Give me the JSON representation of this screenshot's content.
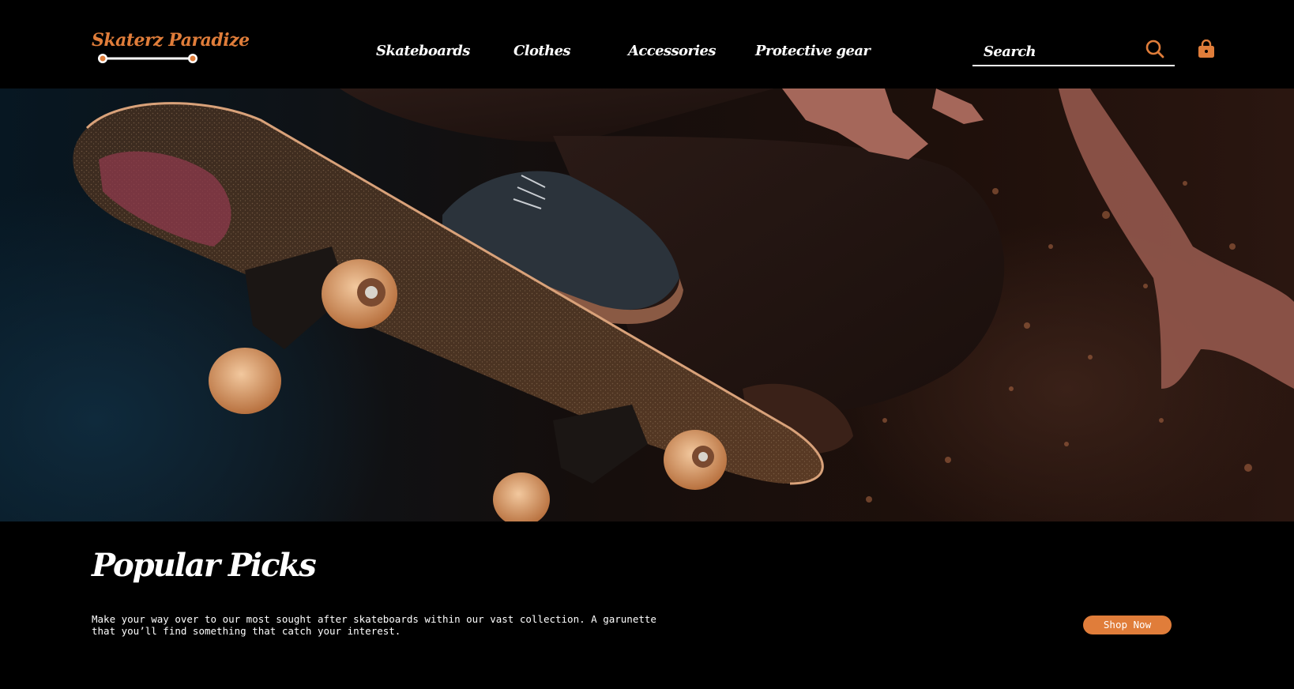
{
  "brand": {
    "name": "Skaterz Paradize",
    "accent_color": "#e07d3a"
  },
  "nav": {
    "items": [
      {
        "label": "Skateboards"
      },
      {
        "label": "Clothes"
      },
      {
        "label": "Accessories"
      },
      {
        "label": "Protective gear"
      }
    ]
  },
  "search": {
    "placeholder": "Search",
    "icon": "search-icon"
  },
  "cart": {
    "icon": "shopping-bag-icon"
  },
  "hero": {
    "image": "skateboarder mid-air, skateboard underside with wheels"
  },
  "popular": {
    "title": "Popular Picks",
    "description": "Make your way over to our most sought after skateboards within our vast collection. A garunette that you’ll find something that catch your interest.",
    "button_label": "Shop Now"
  }
}
